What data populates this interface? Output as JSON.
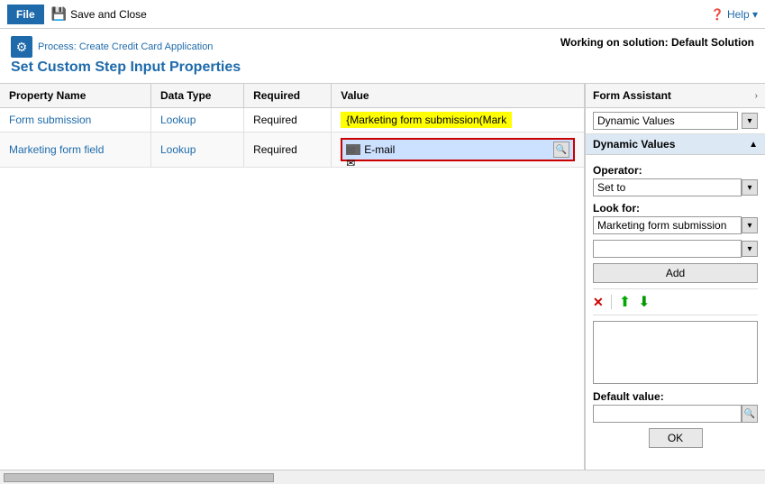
{
  "titleBar": {
    "fileLabel": "File",
    "saveCloseLabel": "Save and Close",
    "helpLabel": "Help"
  },
  "header": {
    "processLabel": "Process: Create Credit Card Application",
    "pageTitle": "Set Custom Step Input Properties",
    "workingSolution": "Working on solution: Default Solution"
  },
  "table": {
    "columns": [
      "Property Name",
      "Data Type",
      "Required",
      "Value"
    ],
    "rows": [
      {
        "propertyName": "Form submission",
        "dataType": "Lookup",
        "required": "Required",
        "value": "{Marketing form submission(Mark",
        "valueType": "yellow"
      },
      {
        "propertyName": "Marketing form field",
        "dataType": "Lookup",
        "required": "Required",
        "value": "E-mail",
        "valueType": "email-input"
      }
    ]
  },
  "formAssistant": {
    "title": "Form Assistant",
    "arrowLabel": "›",
    "dynamicValuesDropdown": "Dynamic Values",
    "dynamicValuesSection": "Dynamic Values",
    "collapsibleLabel": "▲",
    "operatorLabel": "Operator:",
    "operatorValue": "Set to",
    "lookForLabel": "Look for:",
    "lookForValue": "Marketing form submission",
    "lookForDropdown2": "",
    "addLabel": "Add",
    "deleteIconLabel": "✕",
    "upIconLabel": "⬆",
    "downIconLabel": "⬇",
    "defaultValueLabel": "Default value:",
    "okLabel": "OK"
  }
}
